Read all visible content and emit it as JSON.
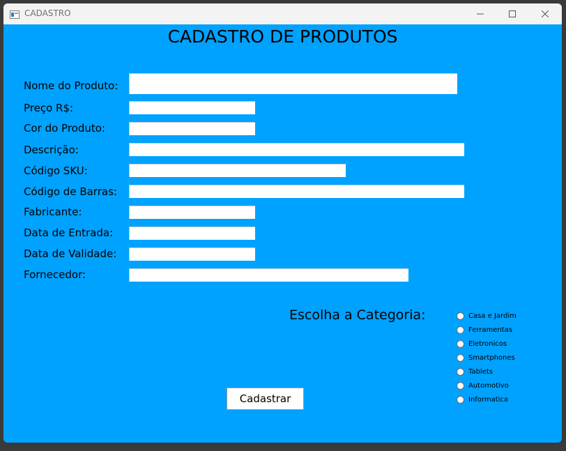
{
  "window": {
    "title": "CADASTRO"
  },
  "form": {
    "heading": "CADASTRO DE PRODUTOS",
    "fields": [
      {
        "label": "Nome do Produto:",
        "value": ""
      },
      {
        "label": " Preço R$:",
        "value": ""
      },
      {
        "label": "Cor do Produto:",
        "value": ""
      },
      {
        "label": "Descrição:",
        "value": ""
      },
      {
        "label": "Código SKU:",
        "value": ""
      },
      {
        "label": "Código de Barras:",
        "value": ""
      },
      {
        "label": "Fabricante:",
        "value": ""
      },
      {
        "label": "Data de Entrada:",
        "value": ""
      },
      {
        "label": "Data de Validade:",
        "value": ""
      },
      {
        "label": "Fornecedor:",
        "value": ""
      }
    ],
    "category_title": "Escolha a Categoria:",
    "categories": [
      "Casa e Jardim",
      "Ferramentas",
      "Eletronicos",
      "Smartphones",
      "Tablets",
      "Automotivo",
      "Informatica"
    ],
    "submit_label": "Cadastrar"
  },
  "icons": {
    "app": "app-window-icon",
    "minimize": "minimize-icon",
    "maximize": "maximize-icon",
    "close": "close-icon"
  },
  "colors": {
    "background": "#00a2ff",
    "titlebar": "#f3f3f3"
  }
}
